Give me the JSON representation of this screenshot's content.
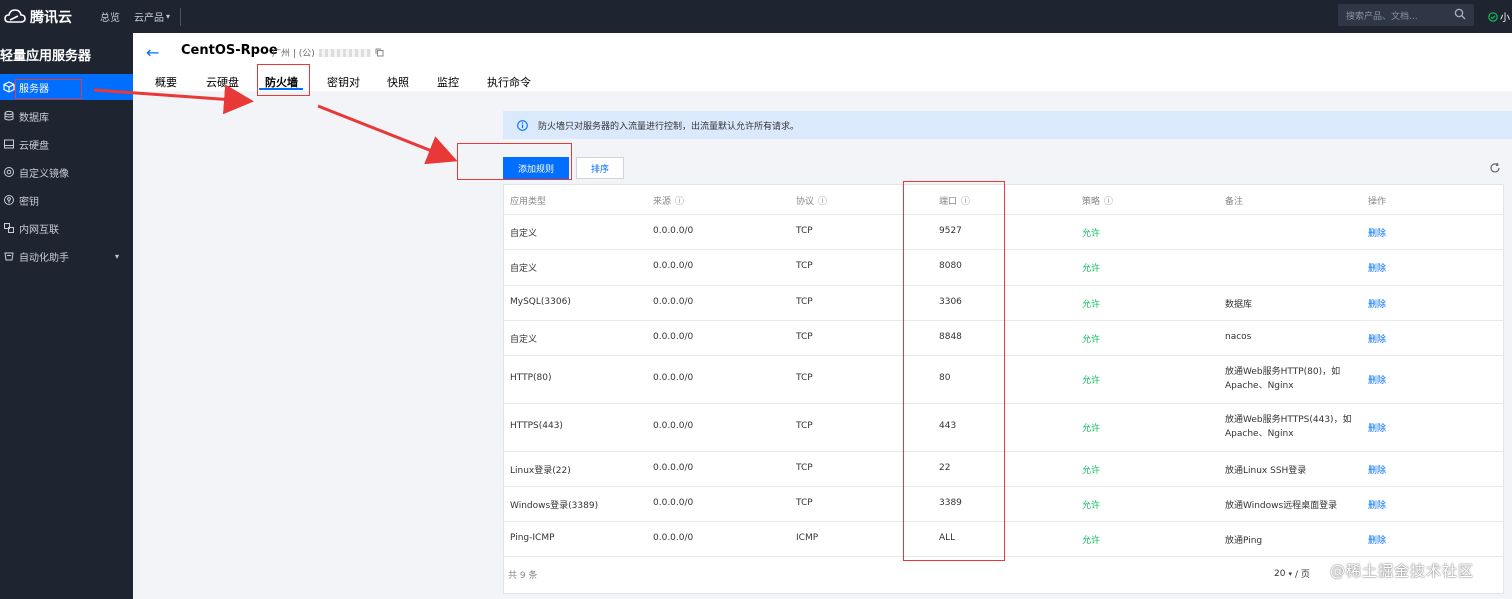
{
  "topbar": {
    "brand": "腾讯云",
    "nav_overview": "总览",
    "nav_products": "云产品",
    "search_placeholder": "搜索产品、文档...",
    "user_text": "小"
  },
  "sidebar": {
    "title": "轻量应用服务器",
    "items": [
      {
        "label": "服务器",
        "icon": "server-icon",
        "active": true
      },
      {
        "label": "数据库",
        "icon": "database-icon"
      },
      {
        "label": "云硬盘",
        "icon": "disk-icon"
      },
      {
        "label": "自定义镜像",
        "icon": "image-icon"
      },
      {
        "label": "密钥",
        "icon": "key-icon"
      },
      {
        "label": "内网互联",
        "icon": "network-icon"
      },
      {
        "label": "自动化助手",
        "icon": "automation-icon"
      }
    ]
  },
  "header": {
    "instance_name": "CentOS-Rpoe",
    "region": "广州 | (公)"
  },
  "tabs": [
    "概要",
    "云硬盘",
    "防火墙",
    "密钥对",
    "快照",
    "监控",
    "执行命令"
  ],
  "active_tab": "防火墙",
  "banner": {
    "text": "防火墙只对服务器的入流量进行控制，出流量默认允许所有请求。"
  },
  "buttons": {
    "add_rule": "添加规则",
    "sort": "排序"
  },
  "table": {
    "columns": [
      "应用类型",
      "来源",
      "协议",
      "端口",
      "策略",
      "备注",
      "操作"
    ],
    "rows": [
      {
        "type": "自定义",
        "source": "0.0.0.0/0",
        "protocol": "TCP",
        "port": "9527",
        "policy": "允许",
        "note": "",
        "action": "删除"
      },
      {
        "type": "自定义",
        "source": "0.0.0.0/0",
        "protocol": "TCP",
        "port": "8080",
        "policy": "允许",
        "note": "",
        "action": "删除"
      },
      {
        "type": "MySQL(3306)",
        "source": "0.0.0.0/0",
        "protocol": "TCP",
        "port": "3306",
        "policy": "允许",
        "note": "数据库",
        "action": "删除"
      },
      {
        "type": "自定义",
        "source": "0.0.0.0/0",
        "protocol": "TCP",
        "port": "8848",
        "policy": "允许",
        "note": "nacos",
        "action": "删除"
      },
      {
        "type": "HTTP(80)",
        "source": "0.0.0.0/0",
        "protocol": "TCP",
        "port": "80",
        "policy": "允许",
        "note": "放通Web服务HTTP(80)，如Apache、Nginx",
        "action": "删除"
      },
      {
        "type": "HTTPS(443)",
        "source": "0.0.0.0/0",
        "protocol": "TCP",
        "port": "443",
        "policy": "允许",
        "note": "放通Web服务HTTPS(443)，如Apache、Nginx",
        "action": "删除"
      },
      {
        "type": "Linux登录(22)",
        "source": "0.0.0.0/0",
        "protocol": "TCP",
        "port": "22",
        "policy": "允许",
        "note": "放通Linux SSH登录",
        "action": "删除"
      },
      {
        "type": "Windows登录(3389)",
        "source": "0.0.0.0/0",
        "protocol": "TCP",
        "port": "3389",
        "policy": "允许",
        "note": "放通Windows远程桌面登录",
        "action": "删除"
      },
      {
        "type": "Ping-ICMP",
        "source": "0.0.0.0/0",
        "protocol": "ICMP",
        "port": "ALL",
        "policy": "允许",
        "note": "放通Ping",
        "action": "删除"
      }
    ],
    "total": "共 9 条",
    "page_size": "20",
    "page_unit": "/ 页"
  },
  "watermark": "@稀土掘金技术社区",
  "colors": {
    "primary": "#006eff",
    "allow": "#0abf5b",
    "annotation": "#e83838",
    "sidebar_bg": "#1e2430"
  }
}
